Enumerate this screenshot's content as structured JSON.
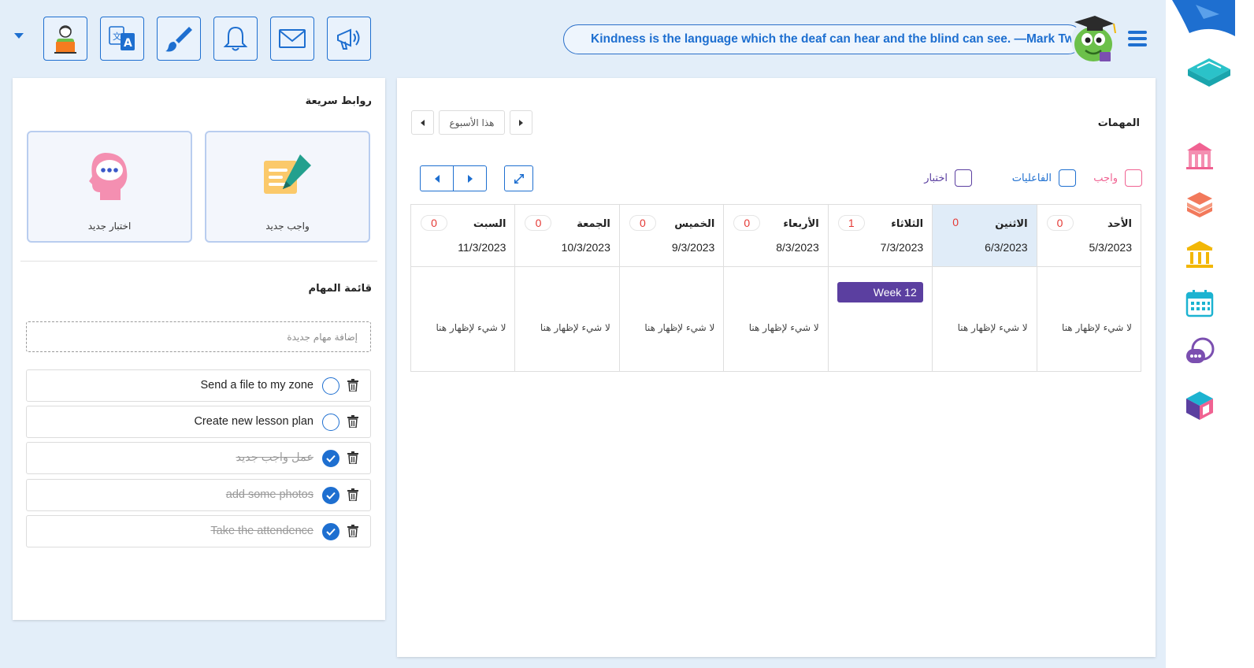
{
  "header": {
    "quote": "Kindness is the language which the deaf can hear and the blind can see. —Mark Twain",
    "toolbar": [
      {
        "name": "profile-button",
        "icon": "student-avatar-icon"
      },
      {
        "name": "translate-button",
        "icon": "translate-icon"
      },
      {
        "name": "theme-button",
        "icon": "paint-brush-icon"
      },
      {
        "name": "notifications-button",
        "icon": "bell-icon"
      },
      {
        "name": "messages-button",
        "icon": "envelope-icon"
      },
      {
        "name": "announcements-button",
        "icon": "megaphone-icon"
      }
    ]
  },
  "colors": {
    "primary": "#1e6fd0",
    "assignment": "#f06292",
    "activities": "#1e6fd0",
    "exam": "#5b3fa0",
    "today_bg": "#e0ecf8",
    "count": "#e53935"
  },
  "quick_links": {
    "title": "روابط سريعة",
    "items": [
      {
        "label": "واجب جديد",
        "icon": "assignment-pen-icon"
      },
      {
        "label": "اختبار جديد",
        "icon": "exam-head-icon"
      }
    ]
  },
  "tasks": {
    "title": "قائمة المهام",
    "add_placeholder": "إضافة مهام جديدة",
    "items": [
      {
        "text": "Send a file to my zone",
        "done": false
      },
      {
        "text": "Create new lesson plan",
        "done": false
      },
      {
        "text": "عمل واجب جديد",
        "done": true
      },
      {
        "text": "add some photos",
        "done": true
      },
      {
        "text": "Take the attendence",
        "done": true
      }
    ]
  },
  "schedule": {
    "title": "المهمات",
    "week_label": "هذا الأسبوع",
    "legend": [
      {
        "label": "واجب",
        "color": "#f06292"
      },
      {
        "label": "الفاعليات",
        "color": "#1e6fd0"
      },
      {
        "label": "اختبار",
        "color": "#5b3fa0"
      }
    ],
    "empty_text": "لا شيء لإظهار هنا",
    "days": [
      {
        "name": "الأحد",
        "date": "5/3/2023",
        "count": "0"
      },
      {
        "name": "الاثنين",
        "date": "6/3/2023",
        "count": "0",
        "today": true
      },
      {
        "name": "الثلاثاء",
        "date": "7/3/2023",
        "count": "1",
        "event": "Week 12"
      },
      {
        "name": "الأربعاء",
        "date": "8/3/2023",
        "count": "0"
      },
      {
        "name": "الخميس",
        "date": "9/3/2023",
        "count": "0"
      },
      {
        "name": "الجمعة",
        "date": "10/3/2023",
        "count": "0"
      },
      {
        "name": "السبت",
        "date": "11/3/2023",
        "count": "0"
      }
    ]
  },
  "sidebar": {
    "items": [
      {
        "icon": "school-building-icon"
      },
      {
        "icon": "books-stack-icon"
      },
      {
        "icon": "institution-icon"
      },
      {
        "icon": "calendar-icon"
      },
      {
        "icon": "chat-bubbles-icon"
      },
      {
        "icon": "cube-app-icon"
      }
    ]
  }
}
